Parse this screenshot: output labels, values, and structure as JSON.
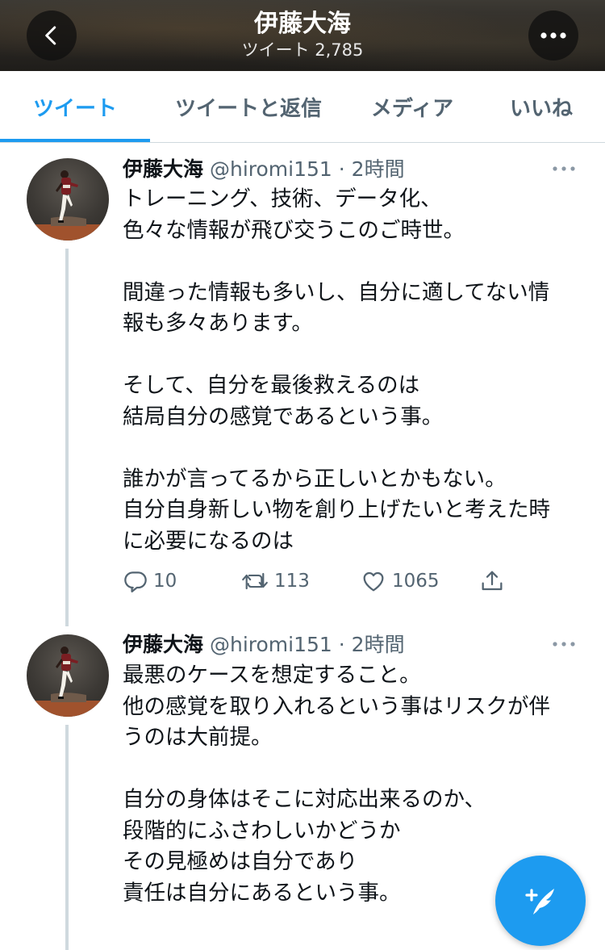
{
  "header": {
    "title": "伊藤大海",
    "subtitle": "ツイート 2,785"
  },
  "tabs": [
    {
      "label": "ツイート",
      "active": true
    },
    {
      "label": "ツイートと返信",
      "active": false
    },
    {
      "label": "メディア",
      "active": false
    },
    {
      "label": "いいね",
      "active": false
    }
  ],
  "tweets": [
    {
      "name": "伊藤大海",
      "handle": "@hiromi151",
      "separator": "·",
      "time": "2時間",
      "text": "トレーニング、技術、データ化、\n色々な情報が飛び交うこのご時世。\n\n間違った情報も多いし、自分に適してない情\n報も多々あります。\n\nそして、自分を最後救えるのは\n結局自分の感覚であるという事。\n\n誰かが言ってるから正しいとかもない。\n自分自身新しい物を創り上げたいと考えた時\nに必要になるのは",
      "replies": "10",
      "retweets": "113",
      "likes": "1065"
    },
    {
      "name": "伊藤大海",
      "handle": "@hiromi151",
      "separator": "·",
      "time": "2時間",
      "text": "最悪のケースを想定すること。\n他の感覚を取り入れるという事はリスクが伴\nうのは大前提。\n\n自分の身体はそこに対応出来るのか、\n段階的にふさわしいかどうか\nその見極めは自分であり\n責任は自分にあるという事。"
    }
  ],
  "colors": {
    "accent": "#1d9bf0",
    "secondary_text": "#536471",
    "primary_text": "#0f1419",
    "divider": "#cfd9de"
  },
  "icons": {
    "back": "chevron-left-icon",
    "more": "more-horizontal-icon",
    "reply": "reply-icon",
    "retweet": "retweet-icon",
    "like": "heart-icon",
    "share": "share-icon",
    "compose": "compose-feather-icon"
  }
}
